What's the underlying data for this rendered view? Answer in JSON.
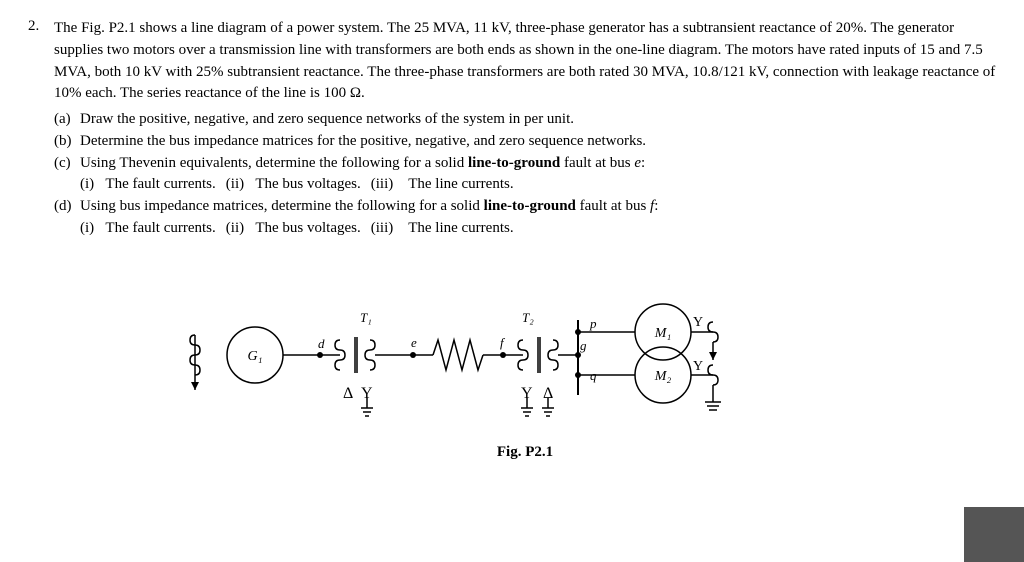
{
  "problem": {
    "number": "2.",
    "paragraph": "The Fig. P2.1 shows a line diagram of a power system. The 25 MVA, 11 kV, three-phase generator has a subtransient reactance of 20%. The generator supplies two motors over a transmission line with transformers are both ends as shown in the one-line diagram. The motors have rated inputs of 15 and 7.5 MVA, both 10 kV with 25% subtransient reactance. The three-phase transformers are both rated 30 MVA, 10.8/121 kV, connection with leakage reactance of 10% each. The series reactance of the line is 100 Ω.",
    "parts": [
      {
        "label": "(a)",
        "text": "Draw the positive, negative, and zero sequence networks of the system in per unit."
      },
      {
        "label": "(b)",
        "text": "Determine the bus impedance matrices for the positive, negative, and zero sequence networks."
      },
      {
        "label": "(c)",
        "text": "Using Thevenin equivalents, determine the following for a solid line-to-ground fault at bus e:",
        "sub": [
          {
            "label": "(i)",
            "text": "The fault currents."
          },
          {
            "label": "(ii)",
            "text": "The bus voltages."
          },
          {
            "label": "(iii)",
            "text": "The line currents."
          }
        ],
        "bold_phrase": "line-to-ground"
      },
      {
        "label": "(d)",
        "text": "Using bus impedance matrices, determine the following for a solid line-to-ground fault at bus f:",
        "sub": [
          {
            "label": "(i)",
            "text": "The fault currents."
          },
          {
            "label": "(ii)",
            "text": "The bus voltages."
          },
          {
            "label": "(iii)",
            "text": "The line currents."
          }
        ],
        "bold_phrase": "line-to-ground"
      }
    ]
  },
  "figure": {
    "caption": "Fig. P2.1"
  },
  "detected_text": "The bus"
}
